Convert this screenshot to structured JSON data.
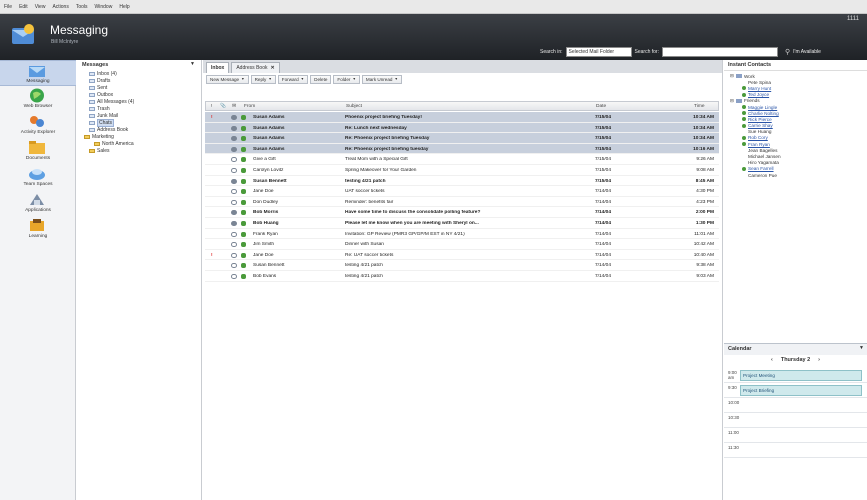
{
  "menu": [
    "File",
    "Edit",
    "View",
    "Actions",
    "Tools",
    "Window",
    "Help"
  ],
  "header": {
    "title": "Messaging",
    "subtitle": "Bill McIntyre",
    "right_text": "1111",
    "search_in_label": "Search in:",
    "search_in_value": "Selected Mail Folder",
    "search_for_label": "Search for:",
    "search_for_value": "",
    "availability": "I'm Available"
  },
  "nav": [
    {
      "label": "Messaging",
      "icon": "messaging-icon"
    },
    {
      "label": "Web Browser",
      "icon": "web-browser-icon"
    },
    {
      "label": "Activity Explorer",
      "icon": "activity-explorer-icon"
    },
    {
      "label": "Documents",
      "icon": "documents-icon"
    },
    {
      "label": "Team Spaces",
      "icon": "team-spaces-icon"
    },
    {
      "label": "Applications",
      "icon": "applications-icon"
    },
    {
      "label": "Learning",
      "icon": "learning-icon"
    }
  ],
  "folders": {
    "title": "Messages",
    "items": [
      {
        "label": "Inbox (4)",
        "indent": 1,
        "selected": false
      },
      {
        "label": "Drafts",
        "indent": 1,
        "selected": false
      },
      {
        "label": "Sent",
        "indent": 1,
        "selected": false
      },
      {
        "label": "Outbox",
        "indent": 1,
        "selected": false
      },
      {
        "label": "All Messages (4)",
        "indent": 1,
        "selected": false
      },
      {
        "label": "Trash",
        "indent": 1,
        "selected": false
      },
      {
        "label": "Junk Mail",
        "indent": 1,
        "selected": false
      },
      {
        "label": "Chats",
        "indent": 1,
        "selected": true
      },
      {
        "label": "Address Book",
        "indent": 1,
        "selected": false
      },
      {
        "label": "Marketing",
        "indent": 0,
        "selected": false
      },
      {
        "label": "North America",
        "indent": 2,
        "selected": false
      },
      {
        "label": "Sales",
        "indent": 1,
        "selected": false
      }
    ]
  },
  "tabs": [
    {
      "label": "Inbox"
    },
    {
      "label": "Address Book"
    }
  ],
  "toolbar": [
    {
      "label": "New Message"
    },
    {
      "label": "Reply"
    },
    {
      "label": "Forward"
    },
    {
      "label": "Delete"
    },
    {
      "label": "Folder"
    },
    {
      "label": "Mark Unread"
    }
  ],
  "columns": {
    "from": "From",
    "subject": "Subject",
    "date": "Date",
    "time": "Time"
  },
  "messages": [
    {
      "flag": "!",
      "from": "Susan Adams",
      "subject": "Phoenix project briefing Tuesday!",
      "date": "7/15/04",
      "time": "10:34 AM",
      "unread": true,
      "highlight": true
    },
    {
      "flag": "",
      "from": "Susan Adams",
      "subject": "Re: Lunch next wednesday",
      "date": "7/15/04",
      "time": "10:34 AM",
      "unread": true,
      "highlight": true
    },
    {
      "flag": "",
      "from": "Susan Adams",
      "subject": "Re: Phoenix project briefing Tuesday",
      "date": "7/15/04",
      "time": "10:34 AM",
      "unread": true,
      "highlight": true
    },
    {
      "flag": "",
      "from": "Susan Adams",
      "subject": "Re: Phoenix project briefing tuesday",
      "date": "7/15/04",
      "time": "10:16 AM",
      "unread": true,
      "highlight": true
    },
    {
      "flag": "",
      "from": "Give a Gift",
      "subject": "Treat Mom with a Special Gift",
      "date": "7/15/04",
      "time": "9:26 AM",
      "unread": false,
      "highlight": false
    },
    {
      "flag": "",
      "from": "Carolyn Lovitz",
      "subject": "Spring Makeover for Your Garden",
      "date": "7/15/04",
      "time": "9:08 AM",
      "unread": false,
      "highlight": false
    },
    {
      "flag": "",
      "from": "Susan Bennett",
      "subject": "testing 4/21 patch",
      "date": "7/15/04",
      "time": "8:45 AM",
      "unread": true,
      "highlight": false
    },
    {
      "flag": "",
      "from": "Jane Doe",
      "subject": "UAT soccer tickets",
      "date": "7/14/04",
      "time": "4:30 PM",
      "unread": false,
      "highlight": false
    },
    {
      "flag": "",
      "from": "Don Dudley",
      "subject": "Reminder: benefits fair",
      "date": "7/14/04",
      "time": "4:23 PM",
      "unread": false,
      "highlight": false
    },
    {
      "flag": "",
      "from": "Bob Morris",
      "subject": "Have some time to discuss the consolidate polling feature?",
      "date": "7/14/04",
      "time": "2:00 PM",
      "unread": true,
      "highlight": false
    },
    {
      "flag": "",
      "from": "Bob Huang",
      "subject": "Please let me know when you are meeting with Sheryl on...",
      "date": "7/14/04",
      "time": "1:30 PM",
      "unread": true,
      "highlight": false
    },
    {
      "flag": "",
      "from": "Frank Ryan",
      "subject": "Invitation: GP Review (PMR3 GP/GP/M EST in NY 4/21)",
      "date": "7/14/04",
      "time": "11:01 AM",
      "unread": false,
      "highlight": false
    },
    {
      "flag": "",
      "from": "Jim Smith",
      "subject": "Dinner with Susan",
      "date": "7/14/04",
      "time": "10:42 AM",
      "unread": false,
      "highlight": false
    },
    {
      "flag": "!",
      "from": "Jane Doe",
      "subject": "Re: UAT soccer tickets",
      "date": "7/14/04",
      "time": "10:40 AM",
      "unread": false,
      "highlight": false
    },
    {
      "flag": "",
      "from": "Susan Bennett",
      "subject": "testing 4/21 patch",
      "date": "7/14/04",
      "time": "9:38 AM",
      "unread": false,
      "highlight": false
    },
    {
      "flag": "",
      "from": "Bob Evans",
      "subject": "testing 4/21 patch",
      "date": "7/14/04",
      "time": "9:03 AM",
      "unread": false,
      "highlight": false
    }
  ],
  "contacts": {
    "title": "Instant Contacts",
    "groups": [
      {
        "name": "Work",
        "members": [
          {
            "name": "Pete Spina",
            "link": false
          },
          {
            "name": "Marry Hunt",
            "link": true
          },
          {
            "name": "Ted Joyce",
            "link": true
          }
        ]
      },
      {
        "name": "Friends",
        "members": [
          {
            "name": "Maggie Lingle",
            "link": true
          },
          {
            "name": "Charlie Nolting",
            "link": true
          },
          {
            "name": "Rick Pierce",
            "link": true
          },
          {
            "name": "Carrie Shay",
            "link": true
          },
          {
            "name": "Sue Huang",
            "link": false
          },
          {
            "name": "Rob Cory",
            "link": true
          },
          {
            "name": "Fran Ryan",
            "link": true
          },
          {
            "name": "Jean Bagelles",
            "link": false
          },
          {
            "name": "Michael Jansen",
            "link": false
          },
          {
            "name": "Hiro Yagamata",
            "link": false
          },
          {
            "name": "Sean Farrell",
            "link": true
          },
          {
            "name": "Cameron Pue",
            "link": false
          }
        ]
      }
    ]
  },
  "calendar": {
    "title": "Calendar",
    "day": "Thursday 2",
    "slots": [
      {
        "hour": "9:00 am",
        "appt": "Project Meeting"
      },
      {
        "hour": "9:30",
        "appt": "Project Briefing"
      },
      {
        "hour": "10:00",
        "appt": ""
      },
      {
        "hour": "10:30",
        "appt": ""
      },
      {
        "hour": "11:00",
        "appt": ""
      },
      {
        "hour": "11:30",
        "appt": ""
      }
    ]
  }
}
